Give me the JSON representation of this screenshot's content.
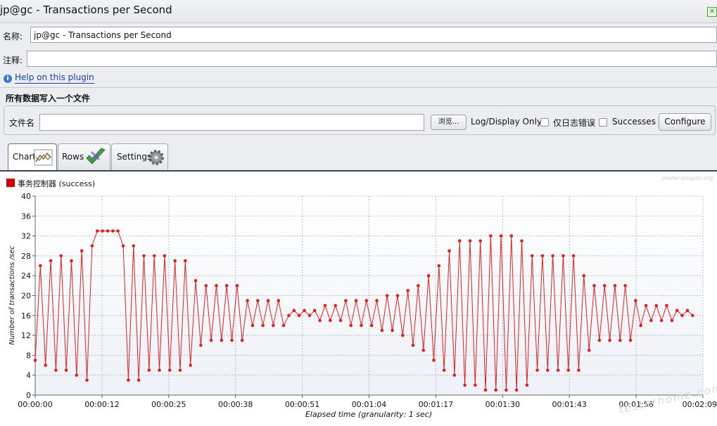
{
  "window": {
    "title": "jp@gc - Transactions per Second",
    "close_symbol": "✕"
  },
  "form": {
    "name_label": "名称:",
    "name_value": "jp@gc - Transactions per Second",
    "comment_label": "注释:",
    "comment_value": ""
  },
  "help": {
    "icon_symbol": "i",
    "link": "Help on this plugin"
  },
  "file_section": {
    "title": "所有数据写入一个文件",
    "filename_label": "文件名",
    "filename_value": "",
    "browse_button": "浏览...",
    "log_display_label": "Log/Display Only:",
    "errors_only_label": "仅日志错误",
    "successes_label": "Successes",
    "configure_button": "Configure"
  },
  "tabs": [
    {
      "label": "Chart",
      "active": true
    },
    {
      "label": "Rows",
      "active": false
    },
    {
      "label": "Settings",
      "active": false
    }
  ],
  "watermarks": {
    "top": "jmeter-plugins.org",
    "bottom": "testerhome.com"
  },
  "colors": {
    "series": "#E02020",
    "legend_swatch": "#D40000"
  },
  "chart_data": {
    "type": "line",
    "title": "",
    "xlabel": "Elapsed time (granularity: 1 sec)",
    "ylabel": "Number of transactions /sec",
    "ylim": [
      0,
      40
    ],
    "xlim": [
      0,
      129
    ],
    "yticks": [
      0,
      4,
      8,
      12,
      16,
      20,
      24,
      28,
      32,
      36,
      40
    ],
    "xticks": [
      {
        "v": 0,
        "label": "00:00:00"
      },
      {
        "v": 12.9,
        "label": "00:00:12"
      },
      {
        "v": 25.8,
        "label": "00:00:25"
      },
      {
        "v": 38.7,
        "label": "00:00:38"
      },
      {
        "v": 51.6,
        "label": "00:00:51"
      },
      {
        "v": 64.5,
        "label": "00:01:04"
      },
      {
        "v": 77.4,
        "label": "00:01:17"
      },
      {
        "v": 90.3,
        "label": "00:01:30"
      },
      {
        "v": 103.2,
        "label": "00:01:43"
      },
      {
        "v": 116.1,
        "label": "00:01:56"
      },
      {
        "v": 129,
        "label": "00:02:09"
      }
    ],
    "grid": true,
    "legend_position": "top-left",
    "series": [
      {
        "name": "事务控制器 (success)",
        "values": [
          7,
          26,
          6,
          27,
          5,
          28,
          5,
          27,
          4,
          29,
          3,
          30,
          33,
          33,
          33,
          33,
          33,
          30,
          3,
          30,
          3,
          28,
          5,
          28,
          5,
          28,
          5,
          27,
          5,
          27,
          6,
          23,
          10,
          22,
          11,
          22,
          11,
          22,
          11,
          22,
          11,
          19,
          14,
          19,
          14,
          19,
          14,
          19,
          14,
          16,
          17,
          16,
          17,
          16,
          17,
          15,
          18,
          15,
          18,
          15,
          19,
          14,
          19,
          14,
          19,
          14,
          19,
          13,
          20,
          13,
          20,
          12,
          21,
          10,
          22,
          9,
          24,
          7,
          26,
          5,
          29,
          4,
          31,
          2,
          31,
          2,
          31,
          1,
          32,
          1,
          32,
          1,
          32,
          1,
          31,
          2,
          28,
          5,
          28,
          5,
          28,
          5,
          28,
          5,
          28,
          5,
          24,
          9,
          22,
          11,
          22,
          11,
          22,
          11,
          22,
          11,
          19,
          14,
          18,
          15,
          18,
          15,
          18,
          15,
          17,
          16,
          17,
          16
        ]
      }
    ]
  }
}
